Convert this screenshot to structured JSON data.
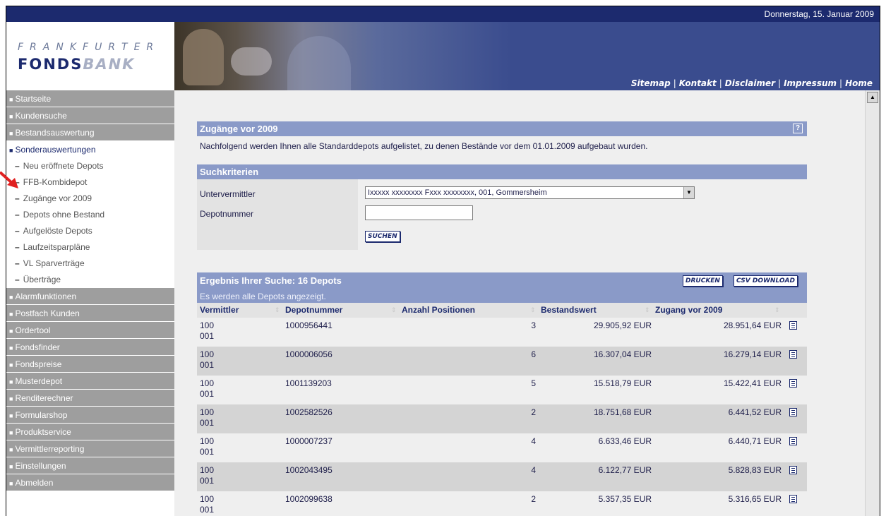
{
  "header": {
    "date": "Donnerstag, 15. Januar 2009",
    "logo_line1": "FRANKFURTER",
    "logo_line2a": "FONDS",
    "logo_line2b": "BANK",
    "nav": [
      "Sitemap",
      "Kontakt",
      "Disclaimer",
      "Impressum",
      "Home"
    ]
  },
  "sidebar": {
    "items": [
      {
        "label": "Startseite",
        "type": "main"
      },
      {
        "label": "Kundensuche",
        "type": "main"
      },
      {
        "label": "Bestandsauswertung",
        "type": "main"
      },
      {
        "label": "Sonderauswertungen",
        "type": "active"
      },
      {
        "label": "Neu eröffnete Depots",
        "type": "sub"
      },
      {
        "label": "FFB-Kombidepot",
        "type": "sub"
      },
      {
        "label": "Zugänge vor 2009",
        "type": "sub"
      },
      {
        "label": "Depots ohne Bestand",
        "type": "sub"
      },
      {
        "label": "Aufgelöste Depots",
        "type": "sub"
      },
      {
        "label": "Laufzeitsparpläne",
        "type": "sub"
      },
      {
        "label": "VL Sparverträge",
        "type": "sub"
      },
      {
        "label": "Überträge",
        "type": "sub"
      },
      {
        "label": "Alarmfunktionen",
        "type": "main"
      },
      {
        "label": "Postfach Kunden",
        "type": "main"
      },
      {
        "label": "Ordertool",
        "type": "main"
      },
      {
        "label": "Fondsfinder",
        "type": "main"
      },
      {
        "label": "Fondspreise",
        "type": "main"
      },
      {
        "label": "Musterdepot",
        "type": "main"
      },
      {
        "label": "Renditerechner",
        "type": "main"
      },
      {
        "label": "Formularshop",
        "type": "main"
      },
      {
        "label": "Produktservice",
        "type": "main"
      },
      {
        "label": "Vermittlerreporting",
        "type": "main"
      },
      {
        "label": "Einstellungen",
        "type": "main"
      },
      {
        "label": "Abmelden",
        "type": "main"
      }
    ]
  },
  "main": {
    "section_title": "Zugänge vor 2009",
    "help_label": "?",
    "intro": "Nachfolgend werden Ihnen alle Standarddepots aufgelistet, zu denen Bestände vor dem 01.01.2009 aufgebaut wurden.",
    "criteria": {
      "title": "Suchkriterien",
      "untervermittler_label": "Untervermittler",
      "untervermittler_value": "Ixxxxx xxxxxxxx Fxxx xxxxxxxx, 001, Gommersheim",
      "depotnummer_label": "Depotnummer",
      "depotnummer_value": "",
      "search_button": "SUCHEN"
    },
    "results": {
      "title": "Ergebnis Ihrer Suche: 16 Depots",
      "subtitle": "Es werden alle Depots angezeigt.",
      "print_button": "DRUCKEN",
      "csv_button": "CSV DOWNLOAD",
      "columns": [
        "Vermittler",
        "Depotnummer",
        "Anzahl Positionen",
        "Bestandswert",
        "Zugang vor 2009"
      ],
      "rows": [
        {
          "vermittler_a": "100",
          "vermittler_b": "001",
          "depotnummer": "1000956441",
          "positionen": "3",
          "bestandswert": "29.905,92 EUR",
          "zugang": "28.951,64 EUR"
        },
        {
          "vermittler_a": "100",
          "vermittler_b": "001",
          "depotnummer": "1000006056",
          "positionen": "6",
          "bestandswert": "16.307,04 EUR",
          "zugang": "16.279,14 EUR"
        },
        {
          "vermittler_a": "100",
          "vermittler_b": "001",
          "depotnummer": "1001139203",
          "positionen": "5",
          "bestandswert": "15.518,79 EUR",
          "zugang": "15.422,41 EUR"
        },
        {
          "vermittler_a": "100",
          "vermittler_b": "001",
          "depotnummer": "1002582526",
          "positionen": "2",
          "bestandswert": "18.751,68 EUR",
          "zugang": "6.441,52 EUR"
        },
        {
          "vermittler_a": "100",
          "vermittler_b": "001",
          "depotnummer": "1000007237",
          "positionen": "4",
          "bestandswert": "6.633,46 EUR",
          "zugang": "6.440,71 EUR"
        },
        {
          "vermittler_a": "100",
          "vermittler_b": "001",
          "depotnummer": "1002043495",
          "positionen": "4",
          "bestandswert": "6.122,77 EUR",
          "zugang": "5.828,83 EUR"
        },
        {
          "vermittler_a": "100",
          "vermittler_b": "001",
          "depotnummer": "1002099638",
          "positionen": "2",
          "bestandswert": "5.357,35 EUR",
          "zugang": "5.316,65 EUR"
        }
      ]
    }
  },
  "colors": {
    "header_dark": "#1c2a6e",
    "banner": "#3a4c8e",
    "panel_head": "#8a9ac8",
    "nav_gray": "#9e9e9e",
    "row_alt": "#d4d4d4",
    "annotation_arrow": "#e02020"
  },
  "icons": {
    "help": "help-icon",
    "row_detail": "document-icon",
    "select": "chevron-down-icon",
    "scroll": "scroll-up-icon",
    "annotation": "red-arrow-icon"
  }
}
